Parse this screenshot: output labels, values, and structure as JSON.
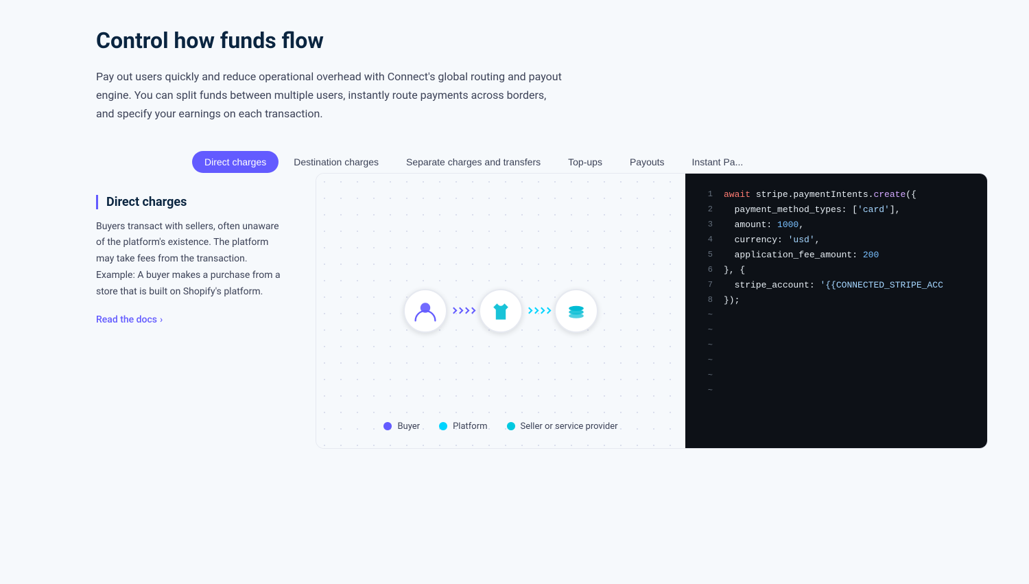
{
  "header": {
    "title": "Control how funds flow",
    "description": "Pay out users quickly and reduce operational overhead with Connect's global routing and payout engine. You can split funds between multiple users, instantly route payments across borders, and specify your earnings on each transaction."
  },
  "tabs": [
    {
      "id": "direct-charges",
      "label": "Direct charges",
      "active": true
    },
    {
      "id": "destination-charges",
      "label": "Destination charges",
      "active": false
    },
    {
      "id": "separate-charges",
      "label": "Separate charges and transfers",
      "active": false
    },
    {
      "id": "top-ups",
      "label": "Top-ups",
      "active": false
    },
    {
      "id": "payouts",
      "label": "Payouts",
      "active": false
    },
    {
      "id": "instant-payouts",
      "label": "Instant Pa...",
      "active": false
    }
  ],
  "active_tab": {
    "title": "Direct charges",
    "description": "Buyers transact with sellers, often unaware of the platform's existence. The platform may take fees from the transaction. Example: A buyer makes a purchase from a store that is built on Shopify's platform.",
    "read_docs": "Read the docs"
  },
  "legend": [
    {
      "label": "Buyer",
      "color": "#635bff"
    },
    {
      "label": "Platform",
      "color": "#00d4ff"
    },
    {
      "label": "Seller or service provider",
      "color": "#00c9e0"
    }
  ],
  "code": {
    "lines": [
      {
        "num": "1",
        "content": "await stripe.paymentIntents.create({",
        "tokens": [
          {
            "text": "await ",
            "class": "c-keyword"
          },
          {
            "text": "stripe.paymentIntents.",
            "class": "c-prop"
          },
          {
            "text": "create",
            "class": "c-func"
          },
          {
            "text": "({",
            "class": "c-prop"
          }
        ]
      },
      {
        "num": "2",
        "content": "  payment_method_types: ['card'],",
        "tokens": [
          {
            "text": "  payment_method_types: [",
            "class": "c-prop"
          },
          {
            "text": "'card'",
            "class": "c-string"
          },
          {
            "text": "],",
            "class": "c-prop"
          }
        ]
      },
      {
        "num": "3",
        "content": "  amount: 1000,",
        "tokens": [
          {
            "text": "  amount: ",
            "class": "c-prop"
          },
          {
            "text": "1000",
            "class": "c-number"
          },
          {
            "text": ",",
            "class": "c-prop"
          }
        ]
      },
      {
        "num": "4",
        "content": "  currency: 'usd',",
        "tokens": [
          {
            "text": "  currency: ",
            "class": "c-prop"
          },
          {
            "text": "'usd'",
            "class": "c-string"
          },
          {
            "text": ",",
            "class": "c-prop"
          }
        ]
      },
      {
        "num": "5",
        "content": "  application_fee_amount: 200",
        "tokens": [
          {
            "text": "  application_fee_amount: ",
            "class": "c-prop"
          },
          {
            "text": "200",
            "class": "c-number"
          }
        ]
      },
      {
        "num": "6",
        "content": "}, {",
        "tokens": [
          {
            "text": "}, {",
            "class": "c-prop"
          }
        ]
      },
      {
        "num": "7",
        "content": "  stripe_account: '{{CONNECTED_STRIPE_ACC",
        "tokens": [
          {
            "text": "  stripe_account: ",
            "class": "c-prop"
          },
          {
            "text": "'{{CONNECTED_STRIPE_ACC",
            "class": "c-string"
          }
        ]
      },
      {
        "num": "8",
        "content": "});",
        "tokens": [
          {
            "text": "});",
            "class": "c-prop"
          }
        ]
      },
      {
        "num": "~",
        "content": "",
        "tokens": []
      },
      {
        "num": "~",
        "content": "",
        "tokens": []
      },
      {
        "num": "~",
        "content": "",
        "tokens": []
      },
      {
        "num": "~",
        "content": "",
        "tokens": []
      },
      {
        "num": "~",
        "content": "",
        "tokens": []
      },
      {
        "num": "~",
        "content": "",
        "tokens": []
      }
    ]
  }
}
